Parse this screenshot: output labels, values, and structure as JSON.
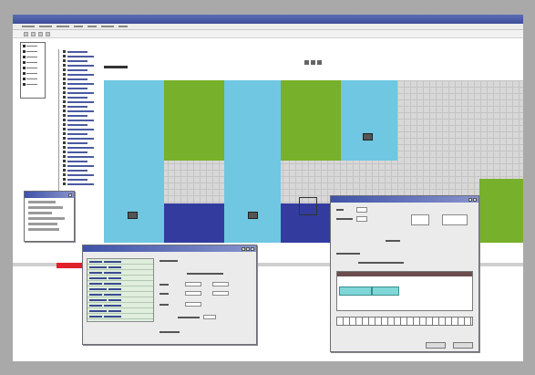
{
  "colors": {
    "cyan": "#6fc7e2",
    "green": "#77b02a",
    "navy": "#333c9e",
    "grid_bg": "#d8d8d8",
    "title_bar": "#3f52a8",
    "status_red": "#e0202a"
  },
  "icons": [
    "window-minimize-icon",
    "window-maximize-icon",
    "window-close-icon",
    "folder-icon",
    "device-chip-icon"
  ]
}
